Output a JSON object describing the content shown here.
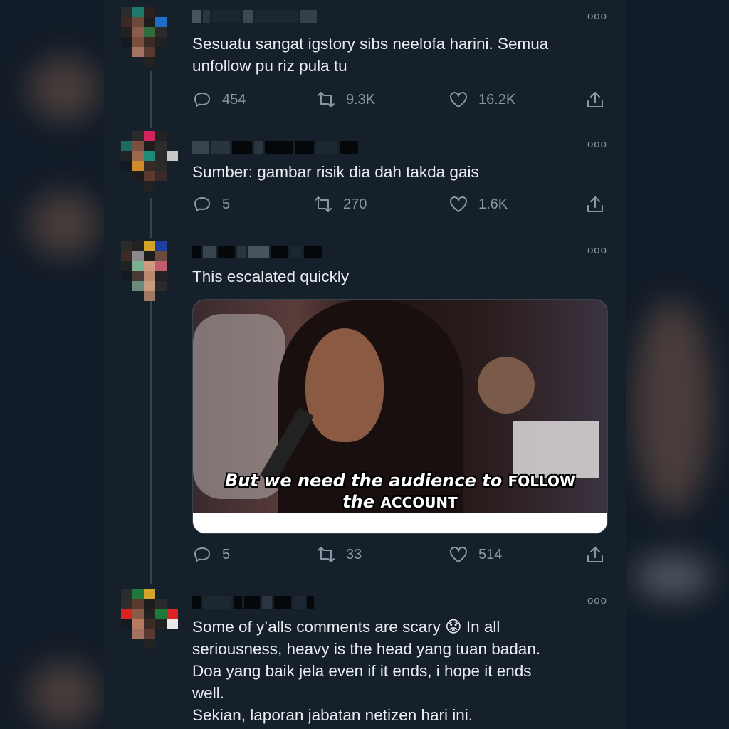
{
  "colors": {
    "background": "#15202b",
    "text": "#e8edf2",
    "muted": "#8899a6",
    "thread_line": "#38444d"
  },
  "tweets": [
    {
      "text": "Sesuatu sangat igstory sibs neelofa harini. Semua\nunfollow pu riz pula tu",
      "more_icon": "more-horizontal-icon",
      "replies": "454",
      "retweets": "9.3K",
      "likes": "16.2K"
    },
    {
      "text": "Sumber: gambar risik dia dah takda gais",
      "more_icon": "more-horizontal-icon",
      "replies": "5",
      "retweets": "270",
      "likes": "1.6K"
    },
    {
      "text": "This escalated quickly",
      "more_icon": "more-horizontal-icon",
      "media": {
        "caption_line1_a": "But we need the audience to ",
        "caption_line1_b": "FOLLOW",
        "caption_line2_a": "the ",
        "caption_line2_b": "ACCOUNT"
      },
      "replies": "5",
      "retweets": "33",
      "likes": "514"
    },
    {
      "text": "Some of y’alls comments are scary 😟 In all\nseriousness, heavy is the head yang tuan badan.\nDoa yang baik jela even if it ends, i hope it ends\nwell.\nSekian, laporan jabatan netizen hari ini.",
      "more_icon": "more-horizontal-icon"
    }
  ],
  "icons": {
    "reply": "reply-icon",
    "retweet": "retweet-icon",
    "like": "heart-icon",
    "share": "share-icon"
  },
  "more_glyph": "ooo"
}
